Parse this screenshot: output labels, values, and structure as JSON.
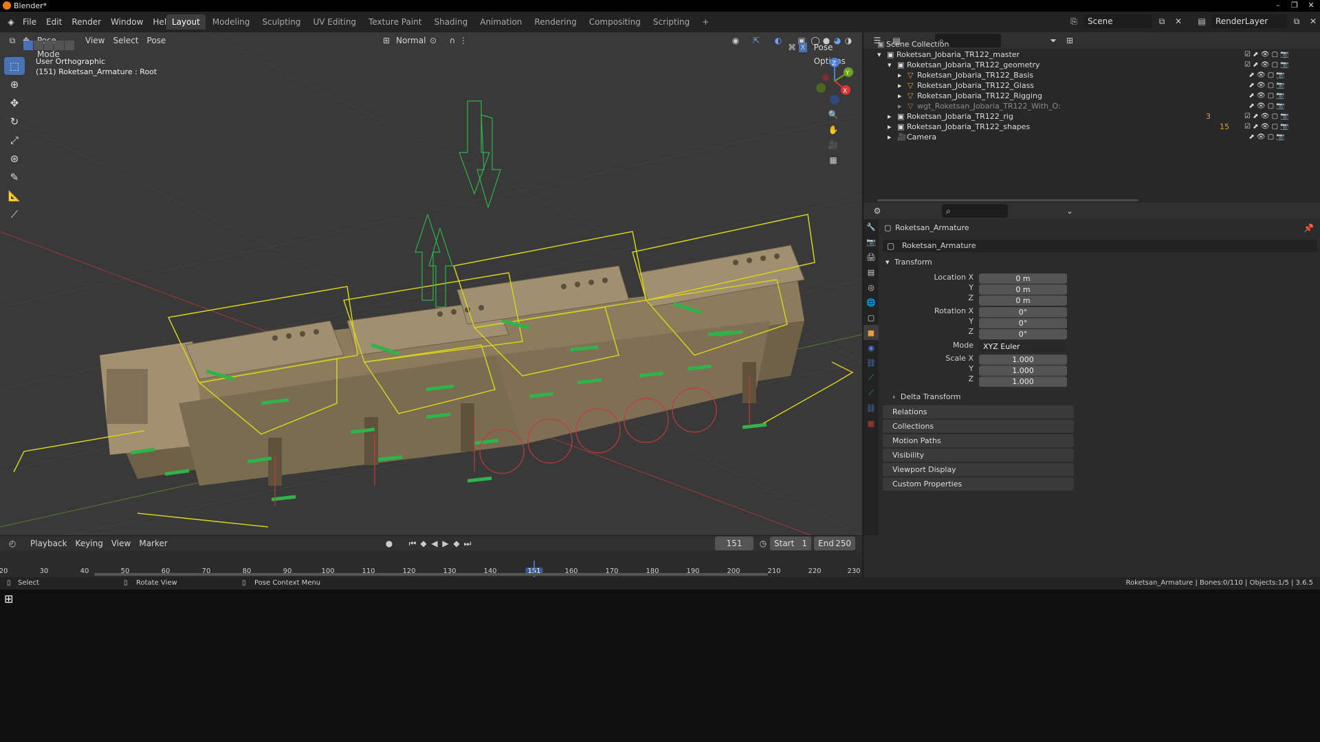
{
  "window": {
    "title": "Blender*",
    "controls": [
      "–",
      "❐",
      "✕"
    ]
  },
  "menubar": {
    "menus": [
      "File",
      "Edit",
      "Render",
      "Window",
      "Help"
    ],
    "workspaces": [
      "Layout",
      "Modeling",
      "Sculpting",
      "UV Editing",
      "Texture Paint",
      "Shading",
      "Animation",
      "Rendering",
      "Compositing",
      "Scripting"
    ],
    "active_workspace": "Layout",
    "add_tab": "+",
    "scene": "Scene",
    "view_layer": "RenderLayer"
  },
  "viewport": {
    "mode": "Pose Mode",
    "menus": [
      "View",
      "Select",
      "Pose"
    ],
    "orientation": "Normal",
    "pose_options": "Pose Options",
    "overlay_text_line1": "User Orthographic",
    "overlay_text_line2": "(151) Roketsan_Armature : Root",
    "gizmo": {
      "z": "Z",
      "y": "Y",
      "x": "X"
    }
  },
  "outliner": {
    "root": "Scene Collection",
    "items": [
      {
        "name": "Roketsan_Jobaria_TR122_master",
        "type": "collection"
      },
      {
        "name": "Roketsan_Jobaria_TR122_geometry",
        "type": "collection"
      },
      {
        "name": "Roketsan_Jobaria_TR122_Basis",
        "type": "mesh"
      },
      {
        "name": "Roketsan_Jobaria_TR122_Glass",
        "type": "mesh"
      },
      {
        "name": "Roketsan_Jobaria_TR122_Rigging",
        "type": "mesh"
      },
      {
        "name": "wgt_Roketsan_Jobaria_TR122_With_O:",
        "type": "mesh"
      },
      {
        "name": "Roketsan_Jobaria_TR122_rig",
        "type": "collection"
      },
      {
        "name": "Roketsan_Jobaria_TR122_shapes",
        "type": "collection"
      },
      {
        "name": "Camera",
        "type": "camera"
      }
    ],
    "badges": {
      "rig": "3",
      "shapes": "15"
    }
  },
  "properties": {
    "object_name": "Roketsan_Armature",
    "data_name": "Roketsan_Armature",
    "transform_header": "Transform",
    "location": {
      "label": "Location X",
      "x": "0 m",
      "y": "0 m",
      "z": "0 m"
    },
    "rotation": {
      "label": "Rotation X",
      "x": "0°",
      "y": "0°",
      "z": "0°"
    },
    "mode_label": "Mode",
    "mode_value": "XYZ Euler",
    "scale": {
      "label": "Scale X",
      "x": "1.000",
      "y": "1.000",
      "z": "1.000"
    },
    "axis_y": "Y",
    "axis_z": "Z",
    "delta_transform": "Delta Transform",
    "sections": [
      "Relations",
      "Collections",
      "Motion Paths",
      "Visibility",
      "Viewport Display",
      "Custom Properties"
    ]
  },
  "timeline": {
    "menus": [
      "Playback",
      "Keying",
      "View",
      "Marker"
    ],
    "current_frame": "151",
    "start_label": "Start",
    "start": "1",
    "end_label": "End",
    "end": "250",
    "ticks": [
      "20",
      "30",
      "40",
      "50",
      "60",
      "70",
      "80",
      "90",
      "100",
      "110",
      "120",
      "130",
      "140",
      "151",
      "160",
      "170",
      "180",
      "190",
      "200",
      "210",
      "220",
      "230"
    ]
  },
  "statusbar": {
    "left": "Select",
    "middle": "Rotate View",
    "right_hint": "Pose Context Menu",
    "info": "Roketsan_Armature | Bones:0/110 | Objects:1/5 | 3.6.5"
  },
  "colors": {
    "accent": "#4772b3",
    "select_yellow": "#d6d21c",
    "bone_green": "#2fb34a",
    "active_frame": "#3b5998",
    "vehicle_tan": "#9c8a68"
  }
}
